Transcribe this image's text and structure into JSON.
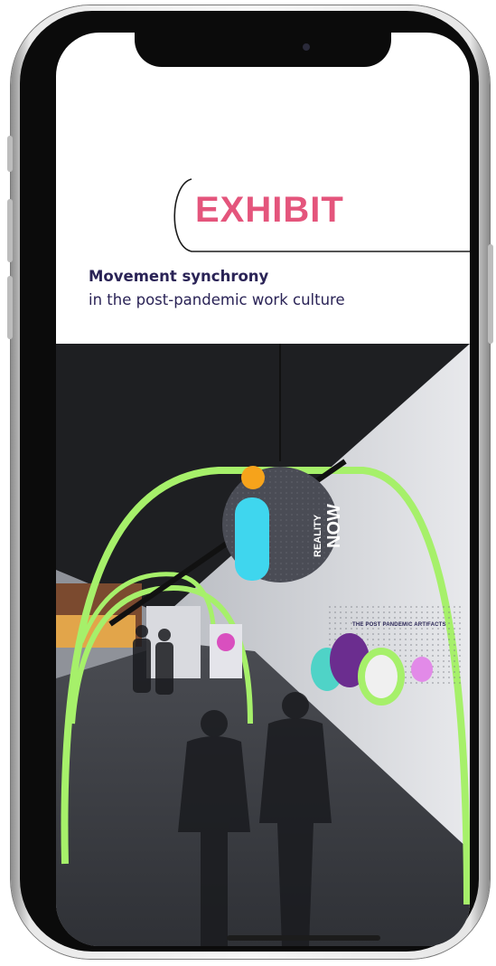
{
  "header": {
    "title": "EXHIBIT",
    "subtitle_strong": "Movement synchrony",
    "subtitle_rest": "in the post-pandemic work culture"
  },
  "scene": {
    "sign_line1": "REALITY",
    "sign_line2": "NOW",
    "wall_label": "THE POST PANDEMIC ARTIFACTS"
  },
  "colors": {
    "accent": "#e4557c",
    "heading": "#2a2356",
    "arch": "#a6f06a",
    "sign_orange": "#f6a31b",
    "sign_cyan": "#3fd6ee"
  }
}
